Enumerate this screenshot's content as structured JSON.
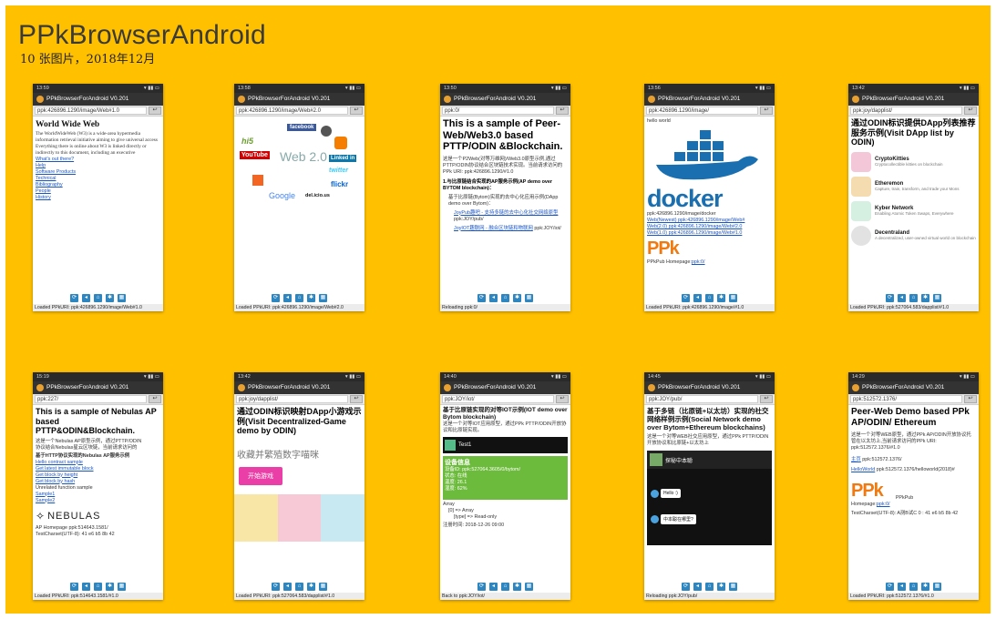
{
  "album": {
    "title": "PPkBrowserAndroid",
    "subtitle": "10 张图片，2018年12月"
  },
  "app_name": "PPkBrowserForAndroid V0.201",
  "go_label": "↩",
  "nav_icons": [
    "refresh-icon",
    "back-icon",
    "home-icon",
    "settings-icon",
    "grid-icon"
  ],
  "phones": [
    {
      "time": "13:59",
      "url": "ppk:426896.1290/image/Web#1.0",
      "footer": "Loaded PPkURI: ppk:426896.1290/image/Web#1.0",
      "title": "World Wide Web",
      "lines": [
        "The WorldWideWeb (W3) is a wide-area hypermedia information retrieval initiative aiming to give universal access",
        "Everything there is online about W3 is linked directly or indirectly to this document, including an executive",
        "What's out there?",
        "Help",
        "Software Products",
        "Technical",
        "Bibliography",
        "People",
        "History"
      ]
    },
    {
      "time": "13:58",
      "url": "ppk:426896.1290/image/Web#2.0",
      "footer": "Loaded PPkURI: ppk:426896.1290/image/Web#2.0",
      "logos": [
        "facebook",
        "hi5",
        "YouTube",
        "Web 2.0",
        "Linked in",
        "twitter",
        "flickr",
        "Google",
        "del.icio.us"
      ]
    },
    {
      "time": "13:50",
      "url": "ppk:0/",
      "footer": "Reloading ppk:0/",
      "title": "This is a sample of Peer-Web/Web3.0 based PTTP/ODIN &Blockchain.",
      "para": "这是一个P2Web(对等万维网)/Web3.0原型示例,通过PTTP/ODIN协议结合区块链技术实现。当前请求访问的PPk URI: ppk:426896.1290/#1.0",
      "sub": "1.与比原链结合实现的AP服务示例(AP demo over BYTOM blockchain)：",
      "bullet": "基于比原链(Bytom)实现的去中心化应用示例(DApp demo over Bytom)：",
      "link1": "JoyPub趣吧 - 支持多链的去中心化社交网络原型",
      "link1_tail": "ppk:JOY/pub/",
      "link2": "JoyIOT趣联网 - 融合区块链和物联网",
      "link2_tail": "ppk:JOY/iot/"
    },
    {
      "time": "13:56",
      "url": "ppk:426896.1290/image/",
      "footer": "Loaded PPkURI: ppk:426896.1290/image/#1.0",
      "hello": "hello world",
      "docker": "docker",
      "lines": [
        "ppk:426896.1290/image/docker",
        "Web(Newest) ppk:426896.1290/image/Web#",
        "Web(2.0) ppk:426896.1290/image/Web#2.0",
        "Web(1.0) ppk:426896.1290/image/Web#1.0"
      ],
      "ppk_logo": "PPk",
      "homepage": "PPkPub Homepage:",
      "homepage_link": "ppk:0/"
    },
    {
      "time": "13:42",
      "url": "ppk:joy/dapplist/",
      "footer": "Loaded PPkURI: ppk:527064.583/dapplist/#1.0",
      "title": "通过ODIN标识提供DApp列表推荐服务示例(Visit DApp list by ODIN)",
      "dapps": [
        {
          "name": "CryptoKitties",
          "desc": "Cryptocollectible kitties on blockchain",
          "color": "#f3c7d8"
        },
        {
          "name": "Etheremon",
          "desc": "Capture, train, transform, and trade your Mons",
          "color": "#f5dcb0"
        },
        {
          "name": "Kyber Network",
          "desc": "Enabling Atomic Token Swaps, Everywhere",
          "color": "#d5efe0"
        },
        {
          "name": "Decentraland",
          "desc": "A decentralized, user-owned virtual world on blockchain",
          "color": "#e2e2e2"
        }
      ]
    },
    {
      "time": "15:19",
      "url": "ppk:227/",
      "footer": "Loaded PPkURI: ppk:514643.1581/#1.0",
      "title": "This is a sample of Nebulas AP based PTTP&ODIN&Blockchain.",
      "lines": [
        "这是一个Nebulas AP原型示例，通过PTTP/ODIN",
        "协议结合Nebulas星云区块链，当前请求访问的",
        "基于HTTP协议实现的Nebulas AP服务示例",
        "Hello contract sample",
        "Get latest immutable block",
        "Get block by height",
        "Get block by hash",
        "Unrelated function sample",
        "Sample1",
        "Sample2"
      ],
      "nebulas": "NEBULAS",
      "tail": [
        "AP Homepage ppk:514643.1581/",
        "TestCharset(UTF-8): 41 e6 b5 8b 42"
      ]
    },
    {
      "time": "13:42",
      "url": "ppk:joy/dapplist/",
      "footer": "Loaded PPkURI: ppk:527064.583/dapplist/#1.0",
      "title": "通过ODIN标识映射DApp小游戏示例(Visit Decentralized-Game demo by ODIN)",
      "game": "收藏并繁殖数字喵咪",
      "start": "开始游戏"
    },
    {
      "time": "14:40",
      "url": "ppk:JOY/iot/",
      "footer": "Back to ppk:JOY/iot/",
      "title": "基于比原链实现的对等IOT示例(IOT demo over Bytom blockchain)",
      "sub": "这是一个对等IOT应用原型，通过PPk PTTP/ODIN开放协议和比原链实现。",
      "device": "Test1",
      "info": "设备信息",
      "lines": [
        "设备ID: ppk:527064.3605/0/bytom/",
        "状态: 在线",
        "温度: 26.1",
        "湿度: 62%",
        "Array",
        "[0] => Array",
        "[type] => Read-only"
      ],
      "time_line": "注册时间: 2018-12-26 09:00"
    },
    {
      "time": "14:45",
      "url": "ppk:JOY/pub/",
      "footer": "Reloading ppk:JOY/pub/",
      "title": "基于多链（比原链+以太坊）实现的社交网络样例示例(Social Network demo over Bytom+Ethereum blockchains)",
      "sub": "这是一个对等WEB社交应用原型，通过PPk PTTP/ODIN开放协议和比原链+以太坊上",
      "chat_header": "探秘中本聪",
      "msg1": "Hello :)",
      "msg2": "中本聪在哪里?"
    },
    {
      "time": "14:29",
      "url": "ppk:512572.1376/",
      "footer": "Loaded PPkURI: ppk:512572.1376/#1.0",
      "title": "Peer-Web Demo based PPk AP/ODIN/ Ethereum",
      "para": "这是一个对等WEB原型，通过PPk AP/ODIN开放协议托管在以太坊上,当前请求访问的PPk URI: ppk:512572.1376/#1.0",
      "link1": "主页",
      "link1_tail": "ppk:512572.1376/",
      "link2": "HelloWorld",
      "link2_tail": "ppk:512572.1376/helloworld(2018)#",
      "ppk_logo": "PPk",
      "ppk_pub": "PPkPub",
      "homepage": "Homepage:",
      "homepage_link": "ppk:0/",
      "charset": "TestCharset(UTF-8): A测B试C 0 : 41 e6 b5 8b 42"
    }
  ]
}
